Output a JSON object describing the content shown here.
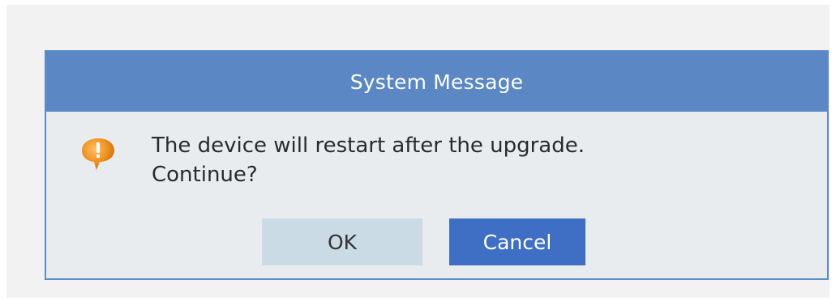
{
  "dialog": {
    "title": "System Message",
    "icon": "warning-speech-bubble-icon",
    "message_line1": "The device will restart after the upgrade.",
    "message_line2": "Continue?",
    "ok_label": "OK",
    "cancel_label": "Cancel"
  },
  "colors": {
    "titlebar": "#5b87c5",
    "dialog_bg": "#e9ecef",
    "ok_button": "#cbdbe6",
    "cancel_button": "#3e6fc4",
    "warning_icon": "#e9861f"
  }
}
